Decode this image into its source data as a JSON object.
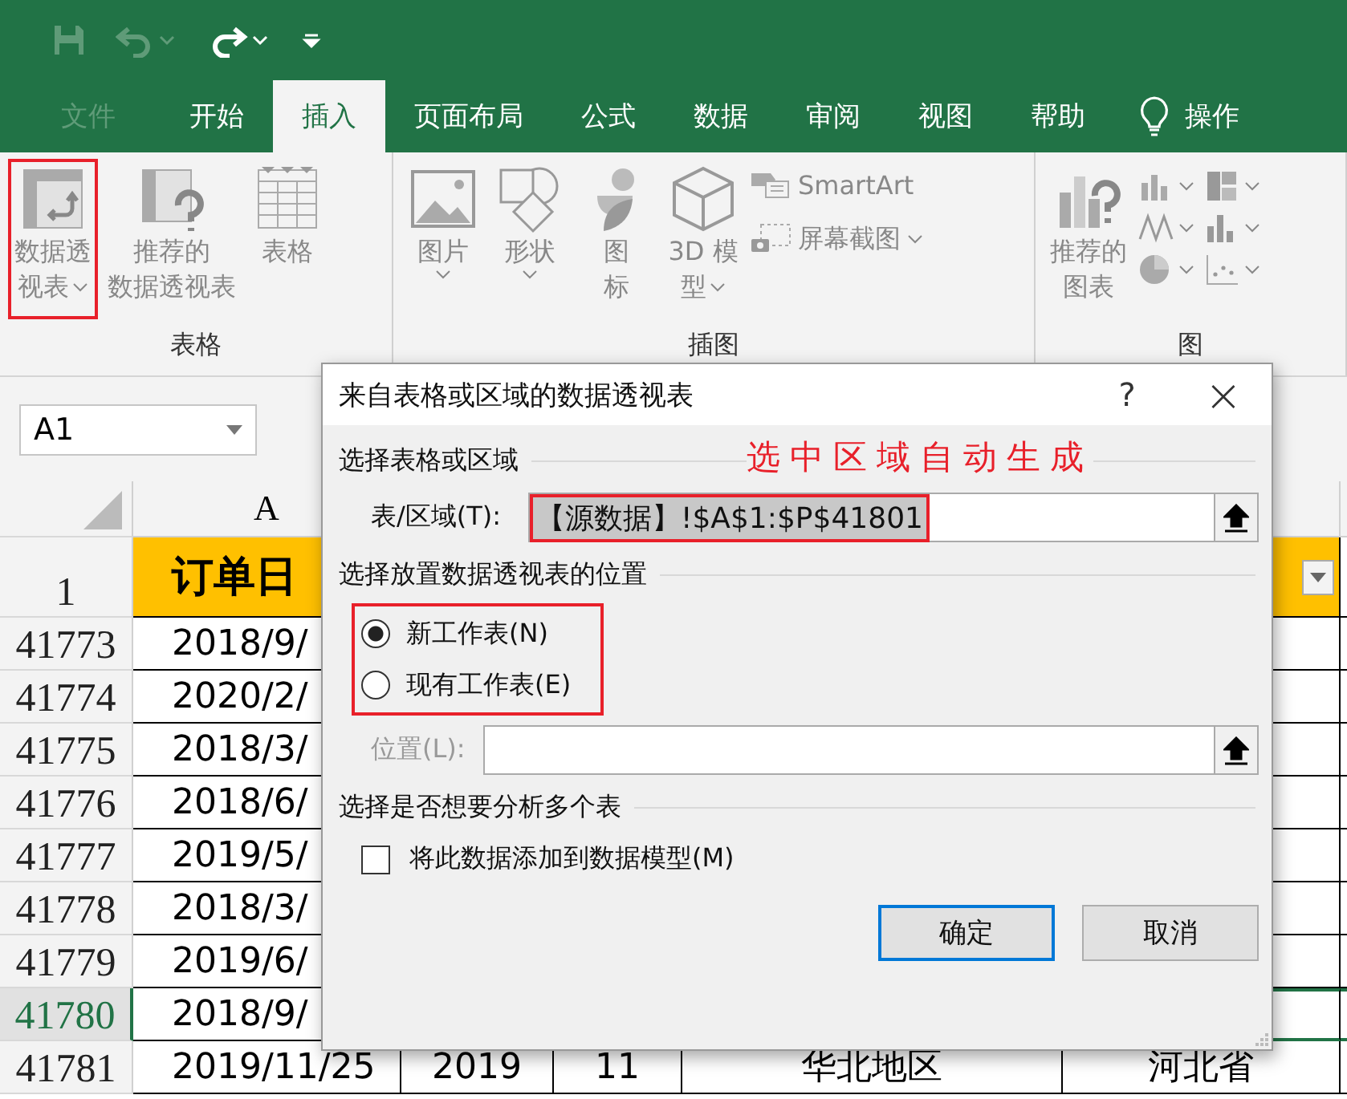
{
  "quick_access": [
    {
      "kind": "save",
      "disabled": true
    },
    {
      "kind": "undo",
      "disabled": true
    },
    {
      "kind": "redo",
      "disabled": false
    },
    {
      "kind": "customize",
      "disabled": false
    }
  ],
  "tabs": [
    {
      "label": "文件",
      "selected": false,
      "disabled": true
    },
    {
      "label": "开始",
      "selected": false,
      "disabled": false
    },
    {
      "label": "插入",
      "selected": true,
      "disabled": false
    },
    {
      "label": "页面布局",
      "selected": false,
      "disabled": false
    },
    {
      "label": "公式",
      "selected": false,
      "disabled": false
    },
    {
      "label": "数据",
      "selected": false,
      "disabled": false
    },
    {
      "label": "审阅",
      "selected": false,
      "disabled": false
    },
    {
      "label": "视图",
      "selected": false,
      "disabled": false
    },
    {
      "label": "帮助",
      "selected": false,
      "disabled": false
    }
  ],
  "tell_me": {
    "label": "操作"
  },
  "ribbon": {
    "groups": [
      {
        "label": "表格",
        "items": [
          {
            "kind": "pivot",
            "lines": [
              "数据透",
              "视表"
            ],
            "dropdown": true,
            "disabled": true,
            "annotated": true
          },
          {
            "kind": "recommended_pivot",
            "lines": [
              "推荐的",
              "数据透视表"
            ],
            "dropdown": false,
            "disabled": true,
            "annotated": false
          },
          {
            "kind": "table",
            "lines": [
              "表格"
            ],
            "dropdown": false,
            "disabled": true,
            "annotated": false
          }
        ]
      },
      {
        "label": "插图",
        "items": [
          {
            "kind": "picture",
            "lines": [
              "图片"
            ],
            "dropdown": true,
            "disabled": true,
            "annotated": false
          },
          {
            "kind": "shapes",
            "lines": [
              "形状"
            ],
            "dropdown": true,
            "disabled": true,
            "annotated": false
          },
          {
            "kind": "icons",
            "lines": [
              "图",
              "标"
            ],
            "dropdown": false,
            "disabled": true,
            "annotated": false
          },
          {
            "kind": "model3d",
            "lines": [
              "3D 模",
              "型"
            ],
            "dropdown": true,
            "disabled": true,
            "annotated": false
          },
          {
            "kind": "smartart",
            "lines": [
              "SmartArt"
            ],
            "dropdown": false,
            "disabled": true,
            "annotated": false
          },
          {
            "kind": "screenshot",
            "lines": [
              "屏幕截图"
            ],
            "dropdown": true,
            "disabled": true,
            "annotated": false
          }
        ]
      },
      {
        "label": "图",
        "items": [
          {
            "kind": "recommended_chart",
            "lines": [
              "推荐的",
              "图表"
            ],
            "dropdown": false,
            "disabled": true,
            "annotated": false
          },
          {
            "kind": "chart_grid",
            "dropdown": true,
            "disabled": true,
            "annotated": false
          }
        ]
      }
    ]
  },
  "sheet": {
    "name_box": "A1",
    "columns": [
      "A"
    ],
    "header_row": {
      "number": "1",
      "cells": [
        "订单日"
      ]
    },
    "rows": [
      {
        "number": "41773",
        "selected": false,
        "cells": [
          "2018/9/"
        ]
      },
      {
        "number": "41774",
        "selected": false,
        "cells": [
          "2020/2/"
        ]
      },
      {
        "number": "41775",
        "selected": false,
        "cells": [
          "2018/3/"
        ]
      },
      {
        "number": "41776",
        "selected": false,
        "cells": [
          "2018/6/"
        ]
      },
      {
        "number": "41777",
        "selected": false,
        "cells": [
          "2019/5/"
        ]
      },
      {
        "number": "41778",
        "selected": false,
        "cells": [
          "2018/3/"
        ]
      },
      {
        "number": "41779",
        "selected": false,
        "cells": [
          "2019/6/"
        ]
      },
      {
        "number": "41780",
        "selected": true,
        "cells": [
          "2018/9/"
        ]
      },
      {
        "number": "41781",
        "selected": false,
        "cells": [
          "2019/11/25",
          "2019",
          "11",
          "华北地区",
          "河北省"
        ]
      }
    ]
  },
  "dialog": {
    "title": "来自表格或区域的数据透视表",
    "help": "?",
    "close": "×",
    "annotation": "选中区域自动生成",
    "source_section": "选择表格或区域",
    "source_field": {
      "label": "表/区域(T):",
      "value": "【源数据】!$A$1:$P$41801",
      "annotated": true
    },
    "placement_section": "选择放置数据透视表的位置",
    "placement_annotated": true,
    "placement_options": [
      {
        "label": "新工作表(N)",
        "selected": true
      },
      {
        "label": "现有工作表(E)",
        "selected": false
      }
    ],
    "location_field": {
      "label": "位置(L):",
      "disabled": true
    },
    "multi_section": "选择是否想要分析多个表",
    "data_model": {
      "label": "将此数据添加到数据模型(M)",
      "checked": false
    },
    "buttons": [
      {
        "label": "确定",
        "default": true
      },
      {
        "label": "取消",
        "default": false
      }
    ]
  }
}
